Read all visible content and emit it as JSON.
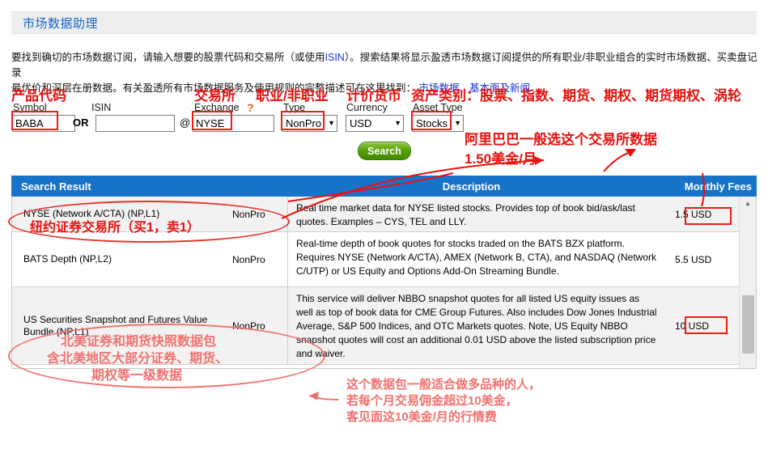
{
  "window": {
    "title": "市场数据助理"
  },
  "intro": {
    "line1_a": "要找到确切的市场数据订阅，请输入想要的股票代码和交易所（或使用",
    "line1_link": "ISIN",
    "line1_b": "）。搜索结果将显示盈透市场数据订阅提供的所有职业",
    "line1_c": "/非职业组合的实时市场数据、买卖盘记录",
    "line2_a": "最优价和深层在册数据。有关盈透所有市场数据服务及使用规则的完整描述可在这里找到：",
    "line2_link": "市场数据、基本面及新闻"
  },
  "form": {
    "symbol_cn": "产品代码",
    "symbol_en": "Symbol",
    "symbol_value": "BABA",
    "isin_en": "ISIN",
    "isin_value": "",
    "or_text": "OR",
    "at_text": "@",
    "exchange_cn": "交易所",
    "exchange_en": "Exchange",
    "exchange_help": "?",
    "exchange_value": "NYSE",
    "type_cn": "职业/非职业",
    "type_en": "Type",
    "type_value": "NonPro",
    "currency_cn": "计价货币",
    "currency_en": "Currency",
    "currency_value": "USD",
    "asset_cn": "资产类别：股票、指数、期货、期权、期货期权、涡轮",
    "asset_en": "Asset Type",
    "asset_value": "Stocks",
    "caret_glyph": "▼",
    "search_label": "Search"
  },
  "results": {
    "columns": [
      "Search Result",
      "Description",
      "Monthly Fees"
    ],
    "rows": [
      {
        "name": "NYSE (Network A/CTA) (NP,L1)",
        "type": "NonPro",
        "description": "Real time market data for NYSE listed stocks. Provides top of book bid/ask/last quotes. Examples – CYS, TEL and LLY.",
        "fee": "1.5 USD"
      },
      {
        "name": "BATS Depth (NP,L2)",
        "type": "NonPro",
        "description": "Real-time depth of book quotes for stocks traded on the BATS BZX platform. Requires NYSE (Network A/CTA), AMEX (Network B, CTA), and NASDAQ (Network C/UTP) or US Equity and Options Add-On Streaming Bundle.",
        "fee": "5.5 USD"
      },
      {
        "name": "US Securities Snapshot and Futures Value Bundle (NP,L1)",
        "type": "NonPro",
        "description": "This service will deliver NBBO snapshot quotes for all listed US equity issues as well as top of book data for CME Group Futures. Also includes Dow Jones Industrial Average, S&P 500 Indices, and OTC Markets quotes. Note, US Equity NBBO snapshot quotes will cost an additional 0.01 USD above the listed subscription price and waiver.",
        "fee": "10 USD"
      }
    ],
    "scroll_up_glyph": "▲"
  },
  "annotations": {
    "exchange_note_line1": "阿里巴巴一般选这个交易所数据",
    "exchange_note_line2_num": "1.50",
    "exchange_note_line2_unit": "美金/月",
    "nyse_note": "纽约证券交易所（买1，卖1）",
    "bundle_note_line1": "北美证券和期货快照数据包",
    "bundle_note_line2": "含北美地区大部分证券、期货、",
    "bundle_note_line3": "期权等一级数据",
    "bottom_note_line1": "这个数据包一般适合做多品种的人，",
    "bottom_note_line2": "若每个月交易佣金超过10美金，",
    "bottom_note_line3": "客见面这10美金/月的行情费"
  },
  "colors": {
    "header_blue": "#1673c8",
    "title_blue": "#1565c8",
    "annotation_red": "#e8110e",
    "annotation_pink": "#f0726f",
    "button_green": "#57a006"
  }
}
